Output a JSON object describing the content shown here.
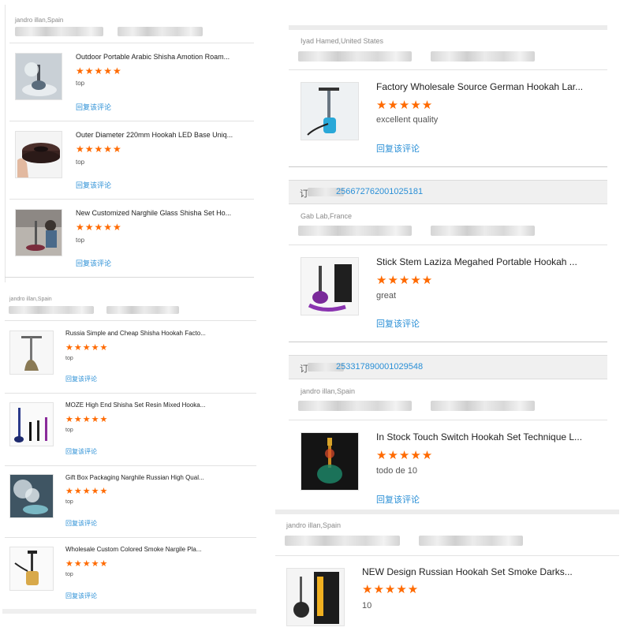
{
  "panel_a": {
    "buyer": "jandro illan,Spain",
    "items": [
      {
        "title": "Outdoor Portable Arabic Shisha Amotion Roam...",
        "stars": "★★★★★",
        "comment": "top",
        "reply": "回复该评论",
        "thumb_icon": "shisha-smoke-photo"
      },
      {
        "title": "Outer Diameter 220mm Hookah LED Base Uniq...",
        "stars": "★★★★★",
        "comment": "top",
        "reply": "回复该评论",
        "thumb_icon": "led-base-photo"
      },
      {
        "title": "New Customized Narghile Glass Shisha Set Ho...",
        "stars": "★★★★★",
        "comment": "top",
        "reply": "回复该评论",
        "thumb_icon": "narghile-photo"
      }
    ]
  },
  "panel_b": {
    "buyer": "jandro illan,Spain",
    "items": [
      {
        "title": "Russia Simple and Cheap Shisha Hookah Facto...",
        "stars": "★★★★★",
        "comment": "top",
        "reply": "回复该评论",
        "thumb_icon": "hookah-bronze-photo"
      },
      {
        "title": "MOZE High End Shisha Set Resin Mixed Hooka...",
        "stars": "★★★★★",
        "comment": "top",
        "reply": "回复该评论",
        "thumb_icon": "hookah-set-photo"
      },
      {
        "title": "Gift Box Packaging Narghile Russian High Qual...",
        "stars": "★★★★★",
        "comment": "top",
        "reply": "回复该评论",
        "thumb_icon": "smoke-photo"
      },
      {
        "title": "Wholesale Custom Colored Smoke Nargile Pla...",
        "stars": "★★★★★",
        "comment": "top",
        "reply": "回复该评论",
        "thumb_icon": "hookah-glass-photo"
      }
    ]
  },
  "panel_c": {
    "section1": {
      "buyer": "Iyad Hamed,United States",
      "title": "Factory Wholesale Source German Hookah Lar...",
      "stars": "★★★★★",
      "comment": "excellent quality",
      "reply": "回复该评论",
      "thumb_icon": "blue-hookah-photo"
    },
    "order1": {
      "prefix": "订",
      "number": "256672762001025181"
    },
    "section2": {
      "buyer": "Gab Lab,France",
      "title": "Stick Stem Laziza Megahed Portable Hookah ...",
      "stars": "★★★★★",
      "comment": "great",
      "reply": "回复该评论",
      "thumb_icon": "purple-hookah-photo"
    },
    "order2": {
      "prefix": "订",
      "number": "253317890001029548"
    },
    "section3": {
      "buyer": "jandro illan,Spain",
      "title": "In Stock Touch Switch Hookah Set Technique L...",
      "stars": "★★★★★",
      "comment": "todo de 10",
      "reply": "回复该评论",
      "thumb_icon": "led-hookah-photo"
    }
  },
  "panel_d": {
    "buyer": "jandro illan,Spain",
    "title": "NEW Design Russian Hookah Set Smoke Darks...",
    "stars": "★★★★★",
    "comment": "10",
    "thumb_icon": "hookah-box-photo"
  },
  "colors": {
    "star": "#ff6a00",
    "link": "#2a8fd6",
    "order_bar": "#f0f0f0"
  }
}
